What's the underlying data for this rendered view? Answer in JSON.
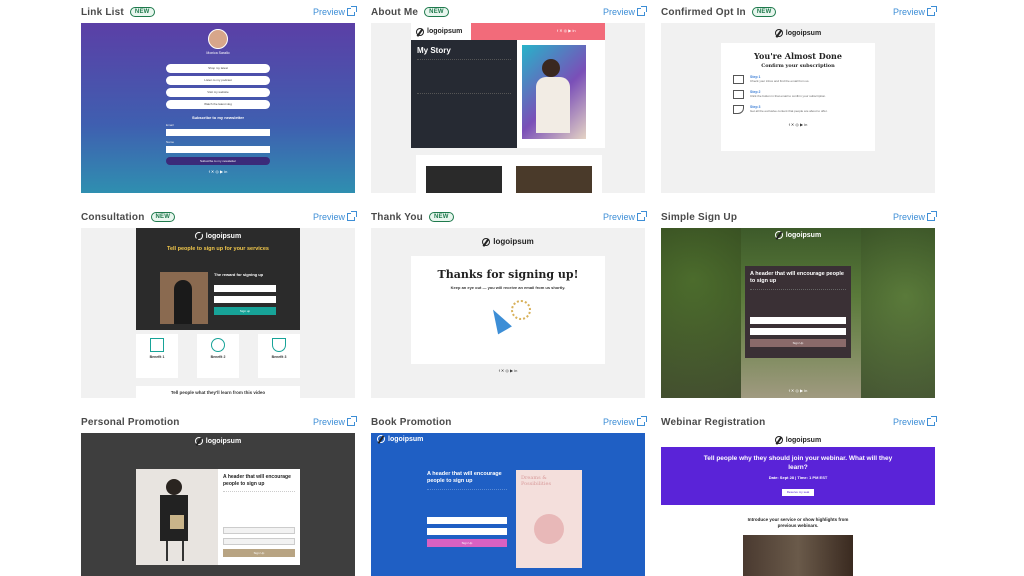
{
  "preview_label": "Preview",
  "new_badge": "NEW",
  "colors": {
    "accent": "#3d8ed6",
    "badge": "#1f7a4d"
  },
  "cards": {
    "link_list": {
      "title": "Link List",
      "name": "Monica Sarallo",
      "links": [
        "Shop my latest",
        "Listen to my podcast",
        "Visit my website",
        "Watch the latest vlog"
      ],
      "newsletter": "Subscribe to my newsletter",
      "email_label": "Email",
      "name_label": "Name",
      "button": "Subscribe to my newsletter"
    },
    "about_me": {
      "title": "About Me",
      "logo": "logoipsum",
      "heading": "My Story"
    },
    "confirmed": {
      "title": "Confirmed Opt In",
      "logo": "logoipsum",
      "heading": "You're Almost Done",
      "subheading": "Confirm your subscription",
      "steps": [
        {
          "label": "Step 1",
          "text": "Check your inbox and find the email from us."
        },
        {
          "label": "Step 2",
          "text": "Click the button in that email to confirm your subscription."
        },
        {
          "label": "Step 3",
          "text": "Get all the exclusive content that people are about to offer."
        }
      ]
    },
    "consultation": {
      "title": "Consultation",
      "logo": "logoipsum",
      "heading": "Tell people to sign up for your services",
      "form_title": "The reward for signing up",
      "button": "Sign up",
      "benefits": [
        "Benefit 1",
        "Benefit 2",
        "Benefit 3"
      ],
      "footer": "Tell people what they'll learn from this video"
    },
    "thank_you": {
      "title": "Thank You",
      "logo": "logoipsum",
      "heading": "Thanks for signing up!",
      "subtext": "Keep an eye out — you will receive an email from us shortly."
    },
    "simple_signup": {
      "title": "Simple Sign Up",
      "logo": "logoipsum",
      "heading": "A header that will encourage people to sign up",
      "button": "Sign Up"
    },
    "personal_promo": {
      "title": "Personal Promotion",
      "logo": "logoipsum",
      "heading": "A header that will encourage people to sign up",
      "button": "Sign Up"
    },
    "book_promo": {
      "title": "Book Promotion",
      "logo": "logoipsum",
      "heading": "A header that will encourage people to sign up",
      "book_title": "Dreams & Possibilities",
      "button": "Sign Up"
    },
    "webinar": {
      "title": "Webinar Registration",
      "logo": "logoipsum",
      "heading": "Tell people why they should join your webinar. What will they learn?",
      "date": "Date: Sept 28 | Time: 1 PM EST",
      "button": "Reserve my seat",
      "intro": "Introduce your service or show highlights from previous webinars."
    }
  }
}
